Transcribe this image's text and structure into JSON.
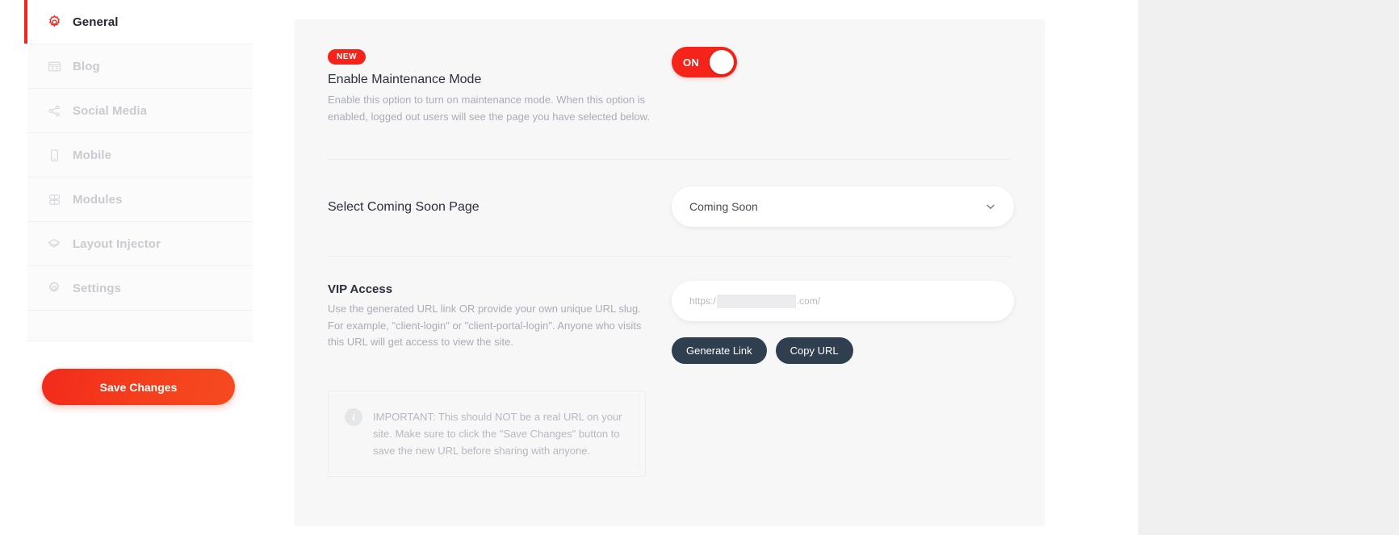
{
  "sidebar": {
    "items": [
      {
        "label": "General",
        "icon": "gear-icon",
        "active": true
      },
      {
        "label": "Blog",
        "icon": "newspaper-icon",
        "active": false
      },
      {
        "label": "Social Media",
        "icon": "share-nodes-icon",
        "active": false
      },
      {
        "label": "Mobile",
        "icon": "mobile-phone-icon",
        "active": false
      },
      {
        "label": "Modules",
        "icon": "modules-grid-icon",
        "active": false
      },
      {
        "label": "Layout Injector",
        "icon": "layers-icon",
        "active": false
      },
      {
        "label": "Settings",
        "icon": "gear-icon",
        "active": false
      }
    ],
    "save_label": "Save Changes"
  },
  "maintenance": {
    "badge": "NEW",
    "title": "Enable Maintenance Mode",
    "description": "Enable this option to turn on maintenance mode. When this option is enabled, logged out users will see the page you have selected below.",
    "toggle_label": "ON",
    "toggle_state": "on"
  },
  "coming_soon": {
    "title": "Select Coming Soon Page",
    "selected": "Coming Soon",
    "chevron": "chevron-down-icon"
  },
  "vip": {
    "title": "VIP Access",
    "description": "Use the generated URL link OR provide your own unique URL slug. For example, \"client-login\" or \"client-portal-login\". Anyone who visits this URL will get access to view the site.",
    "url_prefix": "https:/",
    "url_suffix": ".com/",
    "generate_label": "Generate Link",
    "copy_label": "Copy URL",
    "notice_icon": "info-icon",
    "notice_text": "IMPORTANT: This should NOT be a real URL on your site. Make sure to click the \"Save Changes\" button to save the new URL before sharing with anyone."
  },
  "colors": {
    "accent_red": "#f5231a",
    "button_dark": "#2f3f4f",
    "card_bg": "#f7f7f8",
    "muted_text": "#a9adb5"
  }
}
